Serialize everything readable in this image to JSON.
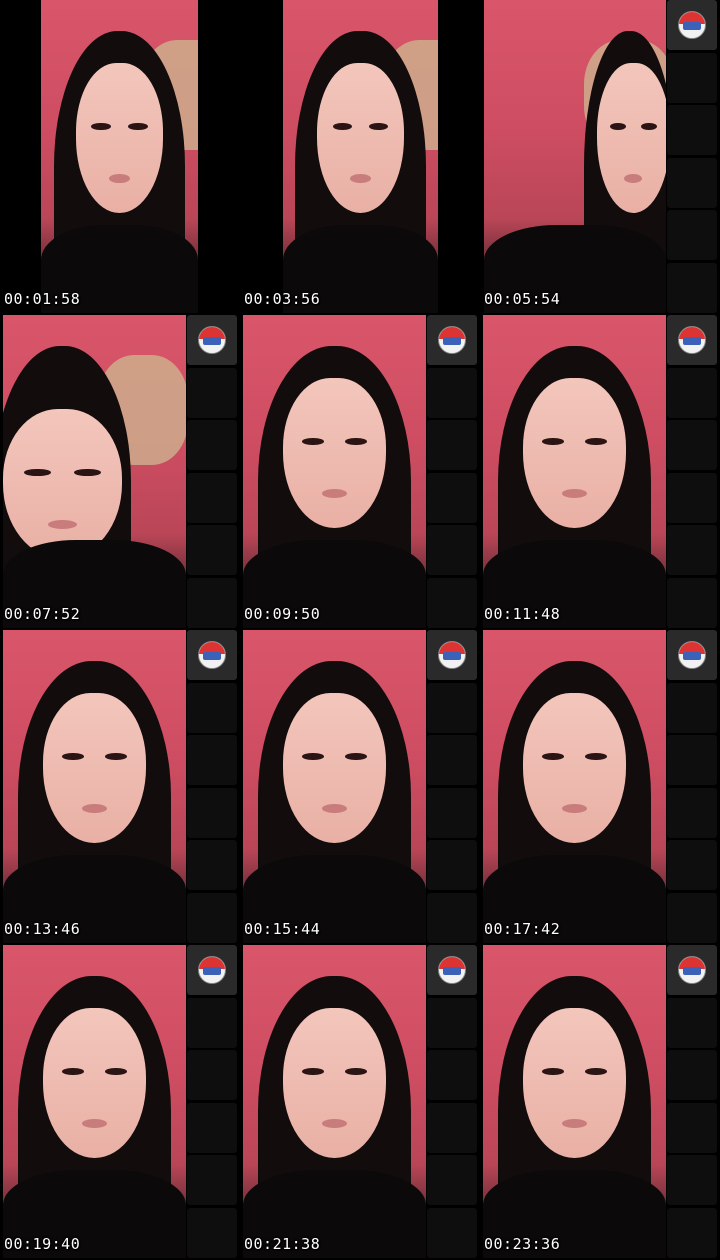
{
  "thumbnails": [
    {
      "timestamp": "00:01:58",
      "scene": "sleepy",
      "show_strip": false
    },
    {
      "timestamp": "00:03:56",
      "scene": "talking",
      "show_strip": false
    },
    {
      "timestamp": "00:05:54",
      "scene": "child-background",
      "show_strip": true
    },
    {
      "timestamp": "00:07:52",
      "scene": "closeup",
      "show_strip": true
    },
    {
      "timestamp": "00:09:50",
      "scene": "talking",
      "show_strip": true
    },
    {
      "timestamp": "00:11:48",
      "scene": "talking",
      "show_strip": true
    },
    {
      "timestamp": "00:13:46",
      "scene": "talking",
      "show_strip": true
    },
    {
      "timestamp": "00:15:44",
      "scene": "talking",
      "show_strip": true
    },
    {
      "timestamp": "00:17:42",
      "scene": "talking",
      "show_strip": true
    },
    {
      "timestamp": "00:19:40",
      "scene": "talking",
      "show_strip": true
    },
    {
      "timestamp": "00:21:38",
      "scene": "talking",
      "show_strip": true
    },
    {
      "timestamp": "00:23:36",
      "scene": "talking",
      "show_strip": true
    }
  ],
  "colors": {
    "wall": "#d9566a",
    "hair": "#120c0d",
    "timestamp": "#ffffff",
    "strip_slot": "#0e0e0e"
  },
  "icons": {
    "strip_logo": "channel-logo-icon"
  }
}
